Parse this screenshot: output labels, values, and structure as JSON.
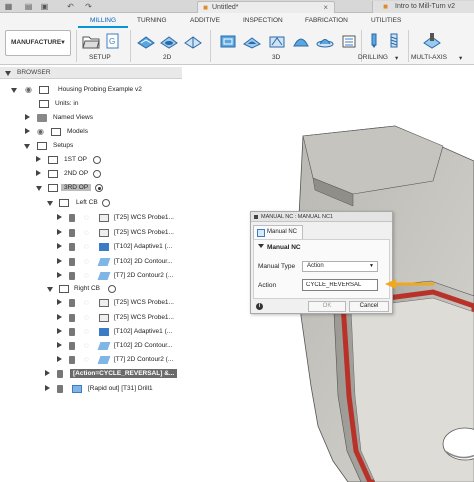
{
  "titlebar": {
    "document_tab": "Untitled*",
    "other_tab": "Intro to Mill-Turn v2"
  },
  "toolbar": {
    "workspace": "MANUFACTURE",
    "tabs": [
      "MILLING",
      "TURNING",
      "ADDITIVE",
      "INSPECTION",
      "FABRICATION",
      "UTILITIES"
    ],
    "active_tab": "MILLING",
    "groups": [
      "SETUP",
      "2D",
      "3D",
      "DRILLING",
      "MULTI-AXIS"
    ]
  },
  "browser": {
    "header": "BROWSER",
    "items": [
      {
        "label": "Housing Probing Example v2"
      },
      {
        "label": "Units: in"
      },
      {
        "label": "Named Views"
      },
      {
        "label": "Models"
      },
      {
        "label": "Setups"
      },
      {
        "label": "1ST OP"
      },
      {
        "label": "2ND OP"
      },
      {
        "label": "3RD OP"
      },
      {
        "label": "Left CB"
      },
      {
        "label": "[T25] WCS Probe1..."
      },
      {
        "label": "[T25] WCS Probe1..."
      },
      {
        "label": "[T102] Adaptive1 (..."
      },
      {
        "label": "[T102] 2D Contour..."
      },
      {
        "label": "[T7] 2D Contour2 (..."
      },
      {
        "label": "Right CB"
      },
      {
        "label": "[T25] WCS Probe1..."
      },
      {
        "label": "[T25] WCS Probe1..."
      },
      {
        "label": "[T102] Adaptive1 (..."
      },
      {
        "label": "[T102] 2D Contour..."
      },
      {
        "label": "[T7] 2D Contour2 (..."
      },
      {
        "label": "[Action=CYCLE_REVERSAL] &..."
      },
      {
        "label": "[Rapid out] [T31] Drill1"
      }
    ]
  },
  "dialog": {
    "title": "MANUAL NC : MANUAL NC1",
    "tab": "Manual NC",
    "section": "Manual NC",
    "manual_type_label": "Manual Type",
    "manual_type_value": "Action",
    "action_label": "Action",
    "action_value": "CYCLE_REVERSAL",
    "ok": "OK",
    "cancel": "Cancel",
    "info": "i"
  },
  "colors": {
    "accent": "#0696d7",
    "arrow": "#f2a81e",
    "part": "#c8c6c0",
    "red_edge": "#b8322a"
  }
}
